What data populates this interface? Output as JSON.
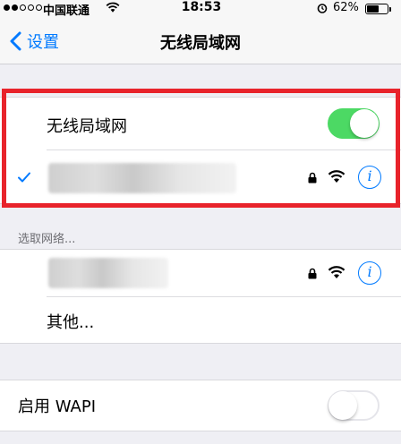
{
  "status_bar": {
    "carrier": "中国联通",
    "time": "18:53",
    "battery_percent": "62%",
    "signal_bars_filled": 2,
    "signal_bars_total": 5,
    "battery_level": 0.62
  },
  "nav": {
    "back_label": "设置",
    "title": "无线局域网"
  },
  "wlan_group": {
    "toggle_label": "无线局域网",
    "toggle_on": true,
    "connected_network": {
      "name_obscured": true,
      "secured": true,
      "info_glyph": "i"
    }
  },
  "choose_network": {
    "header": "选取网络...",
    "networks": [
      {
        "name_obscured": true,
        "secured": true,
        "info_glyph": "i"
      }
    ],
    "other_label": "其他..."
  },
  "wapi": {
    "label": "启用 WAPI",
    "toggle_on": false
  },
  "colors": {
    "accent": "#007aff",
    "toggle_on": "#4cd964",
    "highlight": "#e8232b",
    "background": "#efeff4"
  },
  "icons": [
    "back-chevron-icon",
    "checkmark-icon",
    "lock-icon",
    "wifi-icon",
    "info-icon",
    "alarm-icon",
    "battery-icon"
  ]
}
